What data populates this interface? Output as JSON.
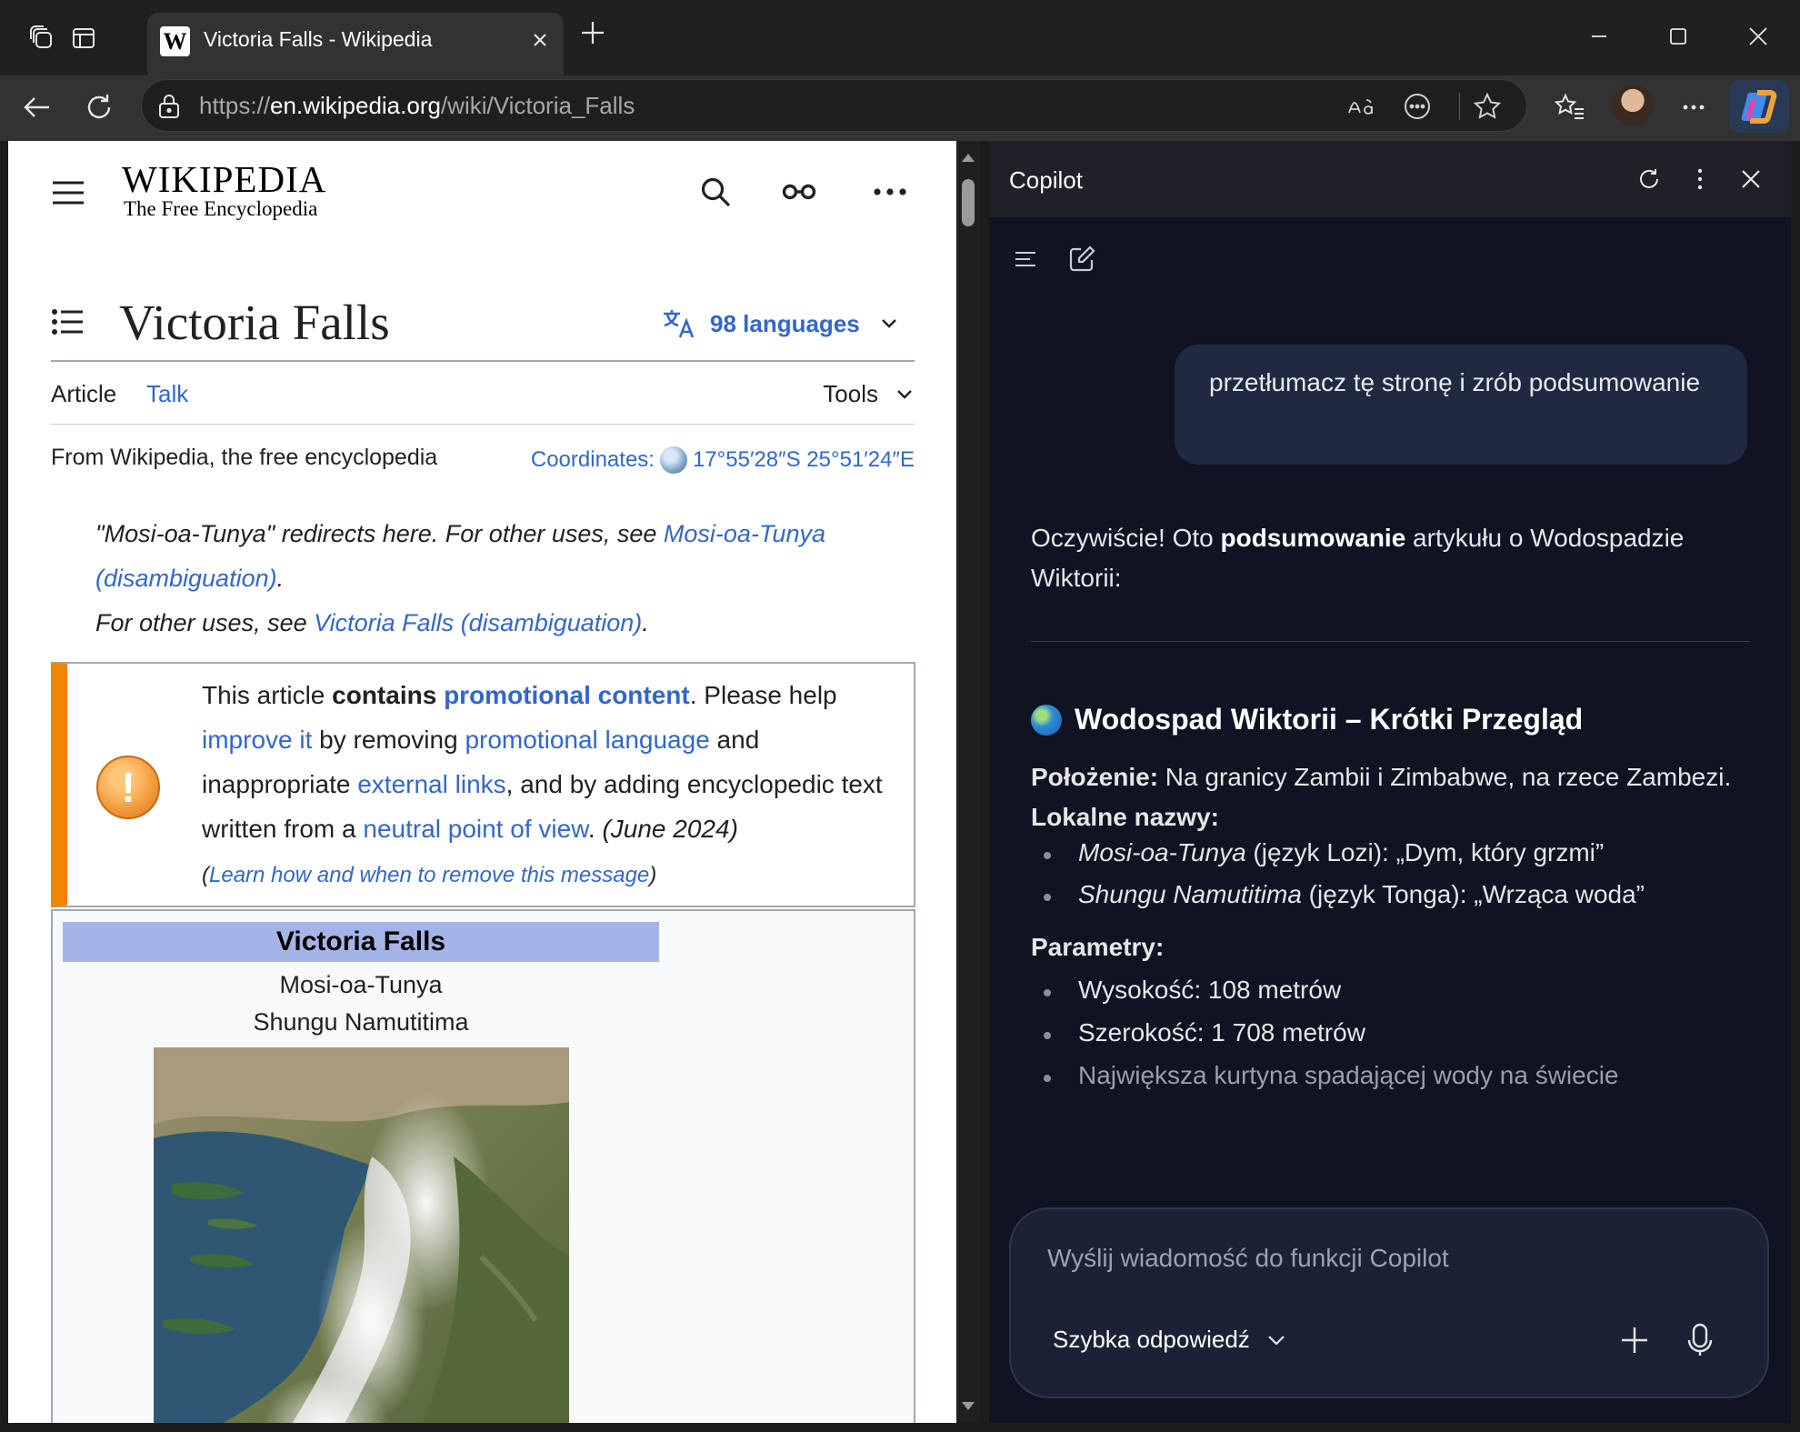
{
  "browser": {
    "tab_title": "Victoria Falls - Wikipedia",
    "tab_favicon_letter": "W",
    "url_prefix": "https://",
    "url_host": "en.wikipedia.org",
    "url_path": "/wiki/Victoria_Falls"
  },
  "wiki": {
    "logo_main": "WIKIPEDIA",
    "logo_tagline": "The Free Encyclopedia",
    "title": "Victoria Falls",
    "languages": "98 languages",
    "tab_article": "Article",
    "tab_talk": "Talk",
    "tools": "Tools",
    "from": "From Wikipedia, the free encyclopedia",
    "coords_label": "Coordinates:",
    "coords_value": "17°55′28″S 25°51′24″E",
    "hatnote": {
      "l1_pre": "\"Mosi-oa-Tunya\" redirects here. For other uses, see ",
      "l1_link": "Mosi-oa-Tunya (disambiguation)",
      "l1_post": ".",
      "l2_pre": "For other uses, see ",
      "l2_link": "Victoria Falls (disambiguation)",
      "l2_post": "."
    },
    "ambox": {
      "t1": "This article ",
      "t2": "contains",
      "t3": " ",
      "link1": "promotional content",
      "t4": ". Please help ",
      "link2": "improve it",
      "t5": " by removing ",
      "link3": "promotional language",
      "t6": " and inappropriate ",
      "link4": "external links",
      "t7": ", and by adding encyclopedic text written from a ",
      "link5": "neutral point of view",
      "t8": ". ",
      "date": "(June 2024)",
      "learn_open": "(",
      "learn_link": "Learn how and when to remove this message",
      "learn_close": ")"
    },
    "infobox": {
      "title": "Victoria Falls",
      "name1": "Mosi-oa-Tunya",
      "name2": "Shungu Namutitima"
    }
  },
  "copilot": {
    "title": "Copilot",
    "user_message": "przetłumacz tę stronę i zrób podsumowanie",
    "intro_pre": "Oczywiście! Oto ",
    "intro_bold": "podsumowanie",
    "intro_post": " artykułu o Wodospadzie Wiktorii:",
    "heading": "Wodospad Wiktorii – Krótki Przegląd",
    "location_label": "Położenie:",
    "location_text": " Na granicy Zambii i Zimbabwe, na rzece Zambezi.",
    "names_label": "Lokalne nazwy:",
    "names": [
      {
        "name": "Mosi-oa-Tunya",
        "desc": " (język Lozi): „Dym, który grzmi”"
      },
      {
        "name": "Shungu Namutitima",
        "desc": " (język Tonga): „Wrząca woda”"
      }
    ],
    "params_label": "Parametry:",
    "params": [
      "Wysokość: 108 metrów",
      "Szerokość: 1 708 metrów",
      "Największa kurtyna spadającej wody na świecie"
    ],
    "input_placeholder": "Wyślij wiadomość do funkcji Copilot",
    "mode": "Szybka odpowiedź"
  }
}
